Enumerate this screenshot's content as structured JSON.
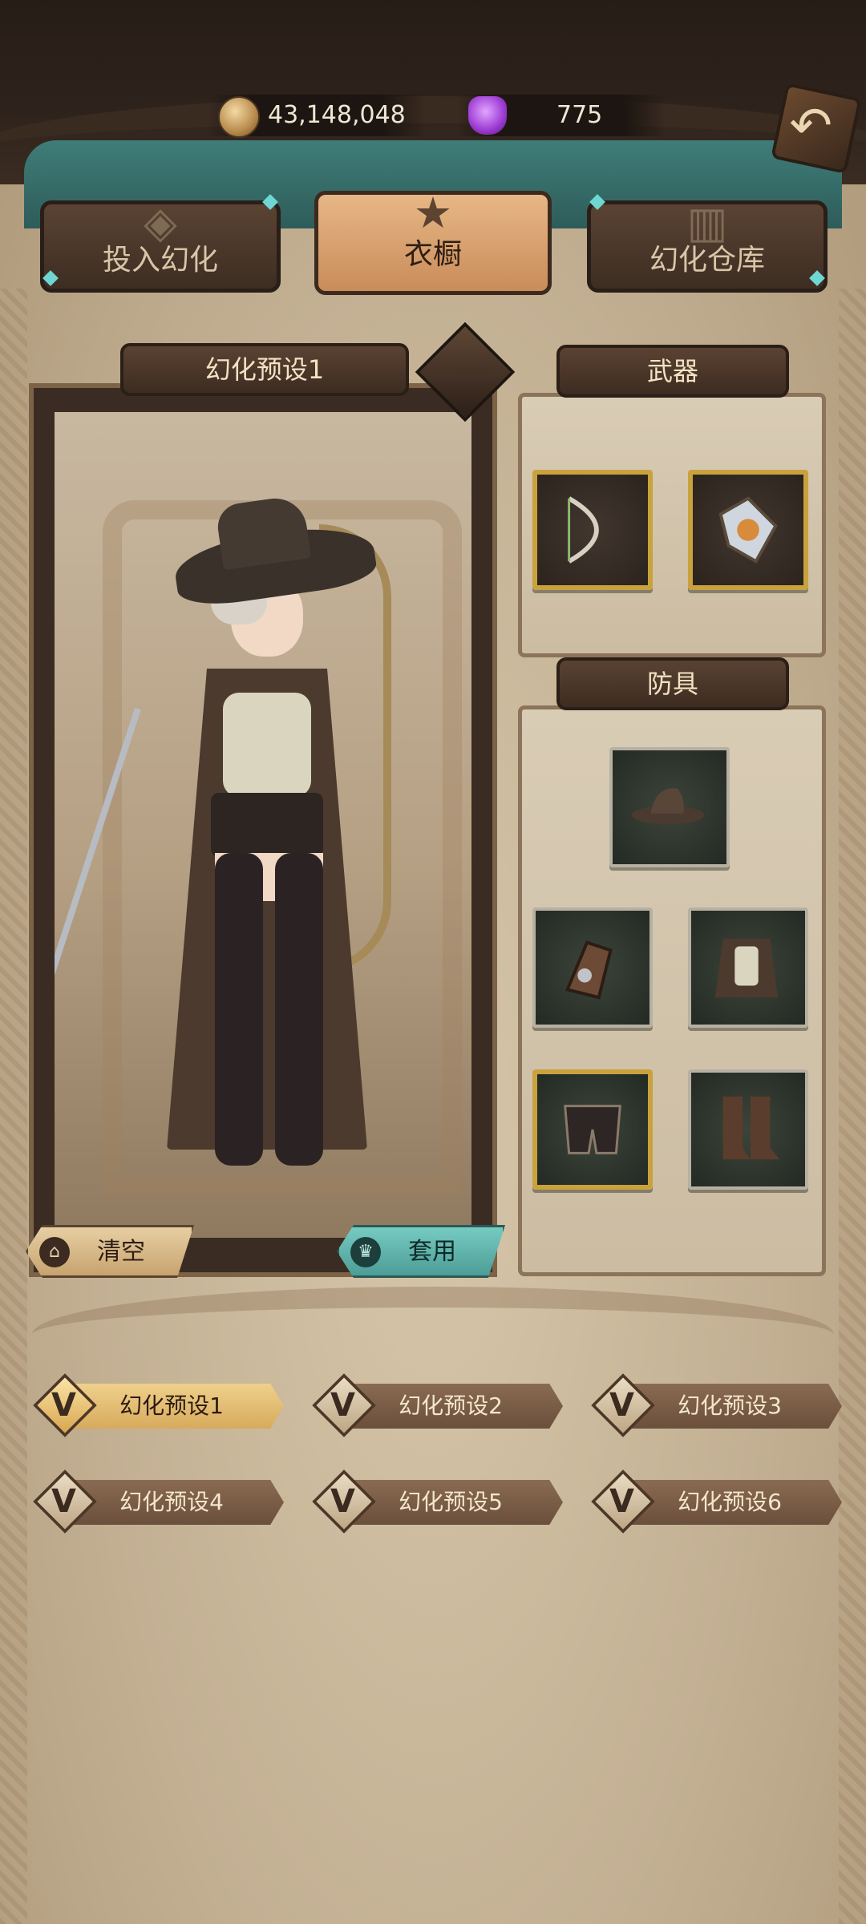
{
  "currency": {
    "gold": "43,148,048",
    "gems": "775"
  },
  "tabs": [
    {
      "label": "投入幻化",
      "active": false
    },
    {
      "label": "衣橱",
      "active": true
    },
    {
      "label": "幻化仓库",
      "active": false
    }
  ],
  "preview": {
    "title": "幻化预设1",
    "clear_label": "清空",
    "apply_label": "套用"
  },
  "weapons": {
    "title": "武器",
    "slots": [
      {
        "icon": "bow-icon"
      },
      {
        "icon": "offhand-icon"
      }
    ]
  },
  "armor": {
    "title": "防具",
    "slots": [
      {
        "icon": "hat-icon"
      },
      {
        "icon": "gloves-icon"
      },
      {
        "icon": "chest-icon"
      },
      {
        "icon": "pants-icon"
      },
      {
        "icon": "boots-icon"
      }
    ]
  },
  "presets": [
    {
      "label": "幻化预设1",
      "active": true
    },
    {
      "label": "幻化预设2",
      "active": false
    },
    {
      "label": "幻化预设3",
      "active": false
    },
    {
      "label": "幻化预设4",
      "active": false
    },
    {
      "label": "幻化预设5",
      "active": false
    },
    {
      "label": "幻化预设6",
      "active": false
    }
  ],
  "colors": {
    "active_tab": "#c98c5a",
    "apply_button": "#4c9d97",
    "clear_button": "#c7a36e",
    "weapon_slot_border": "#c9a23d"
  }
}
